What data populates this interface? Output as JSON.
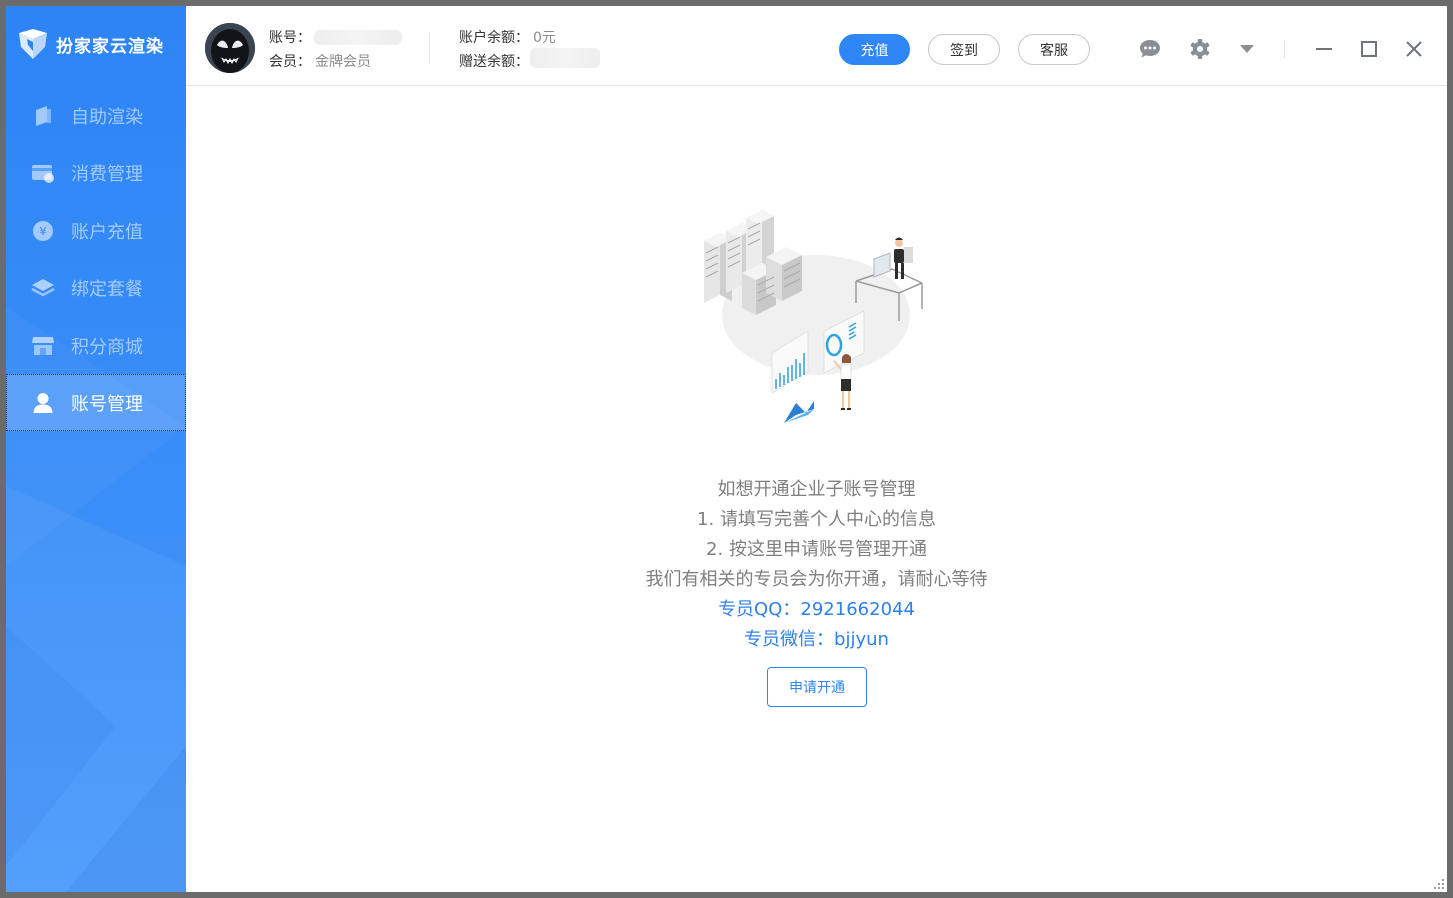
{
  "app": {
    "name": "扮家家云渲染"
  },
  "sidebar": {
    "items": [
      {
        "label": "自助渲染",
        "icon": "self-render-icon"
      },
      {
        "label": "消费管理",
        "icon": "consumption-icon"
      },
      {
        "label": "账户充值",
        "icon": "recharge-coin-icon"
      },
      {
        "label": "绑定套餐",
        "icon": "package-layers-icon"
      },
      {
        "label": "积分商城",
        "icon": "store-icon"
      },
      {
        "label": "账号管理",
        "icon": "user-icon"
      }
    ],
    "active": "账号管理"
  },
  "header": {
    "account_label": "账号：",
    "member_label": "会员：",
    "member_value": "金牌会员",
    "balance_label": "账户余额：",
    "balance_value": "0元",
    "gift_label": "赠送余额：",
    "buttons": {
      "recharge": "充值",
      "signin": "签到",
      "service": "客服"
    },
    "icons": [
      "chat-icon",
      "gear-icon",
      "dropdown-triangle-icon",
      "minimize-icon",
      "maximize-icon",
      "close-icon"
    ]
  },
  "main": {
    "lines": [
      "如想开通企业子账号管理",
      "1. 请填写完善个人中心的信息",
      "2. 按这里申请账号管理开通",
      "我们有相关的专员会为你开通，请耐心等待"
    ],
    "qq": "专员QQ：2921662044",
    "wechat": "专员微信：bjjyun",
    "apply_button": "申请开通"
  },
  "colors": {
    "sidebar": "#2d84f5",
    "primary": "#2f86f6",
    "contact_text": "#2f7fe8",
    "body_text": "#7f7f7f"
  }
}
